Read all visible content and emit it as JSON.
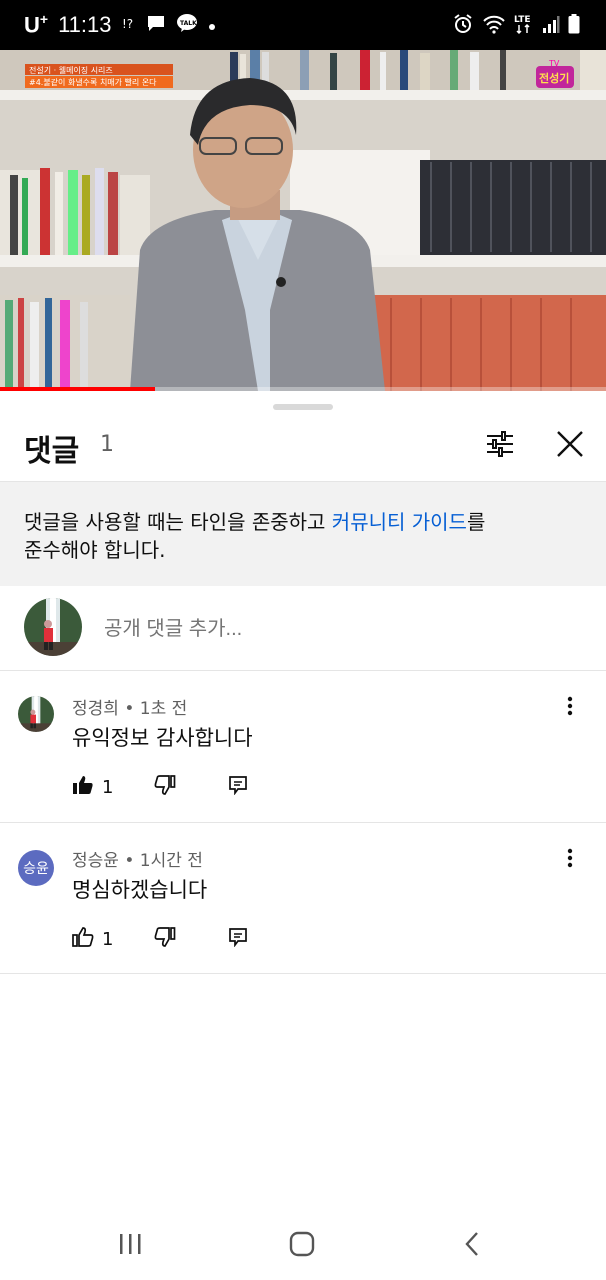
{
  "status_bar": {
    "carrier": "U",
    "carrier_sup": "+",
    "time": "11:13",
    "network_label": "LTE"
  },
  "video": {
    "overlay_series": "전설기 · 웰메이징 시리즈",
    "overlay_title": "#4.불같이 화낼수록 치매가 빨리 온다",
    "channel_logo": "전성기",
    "channel_logo_tv": "TV",
    "progress_fraction": 0.255
  },
  "comments_panel": {
    "title": "댓글",
    "count": "1",
    "notice_text": "댓글을 사용할 때는 타인을 존중하고 ",
    "notice_link": "커뮤니티 가이드",
    "notice_after_link": "를",
    "notice_line2": "준수해야 합니다.",
    "add_comment_placeholder": "공개 댓글 추가..."
  },
  "comments": [
    {
      "author": "정경희",
      "time": "1초 전",
      "text": "유익정보 감사합니다",
      "likes": "1",
      "liked": true,
      "avatar_type": "photo"
    },
    {
      "author": "정승윤",
      "time": "1시간 전",
      "text": "명심하겠습니다",
      "likes": "1",
      "liked": false,
      "avatar_type": "letter",
      "avatar_letters": "승윤",
      "avatar_color": "#5c6bc0"
    }
  ],
  "colors": {
    "link": "#065fd4",
    "progress": "#ff0000",
    "notice_bg": "#f2f2f2"
  }
}
